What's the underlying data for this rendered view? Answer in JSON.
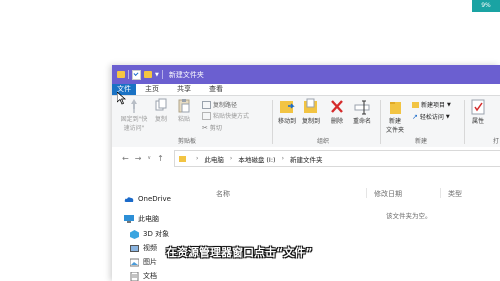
{
  "overlay": {
    "badge": "9%",
    "subtitle": "在资源管理器窗口点击“文件”"
  },
  "window": {
    "title": "新建文件夹"
  },
  "tabs": [
    "文件",
    "主页",
    "共享",
    "查看"
  ],
  "ribbon": {
    "pin_quick_access": [
      "固定到\"快",
      "速访问\""
    ],
    "copy": "复制",
    "paste": "粘贴",
    "copy_path": "复制路径",
    "paste_shortcut": "粘贴快捷方式",
    "cut": "剪切",
    "clipboard_group": "剪贴板",
    "move_to": "移动到",
    "copy_to": "复制到",
    "delete": "删除",
    "rename": "重命名",
    "organize_group": "组织",
    "new_folder": [
      "新建",
      "文件夹"
    ],
    "new_item": "新建项目",
    "easy_access": "轻松访问",
    "new_group": "新建",
    "properties": "属性",
    "open_group_partial": "打"
  },
  "address": {
    "crumbs": [
      "此电脑",
      "本地磁盘 (I:)",
      "新建文件夹"
    ]
  },
  "sidebar": {
    "items": [
      "OneDrive",
      "此电脑",
      "3D 对象",
      "视频",
      "图片",
      "文档"
    ]
  },
  "content": {
    "columns": [
      "名称",
      "修改日期",
      "类型"
    ],
    "empty_text": "该文件夹为空。"
  }
}
